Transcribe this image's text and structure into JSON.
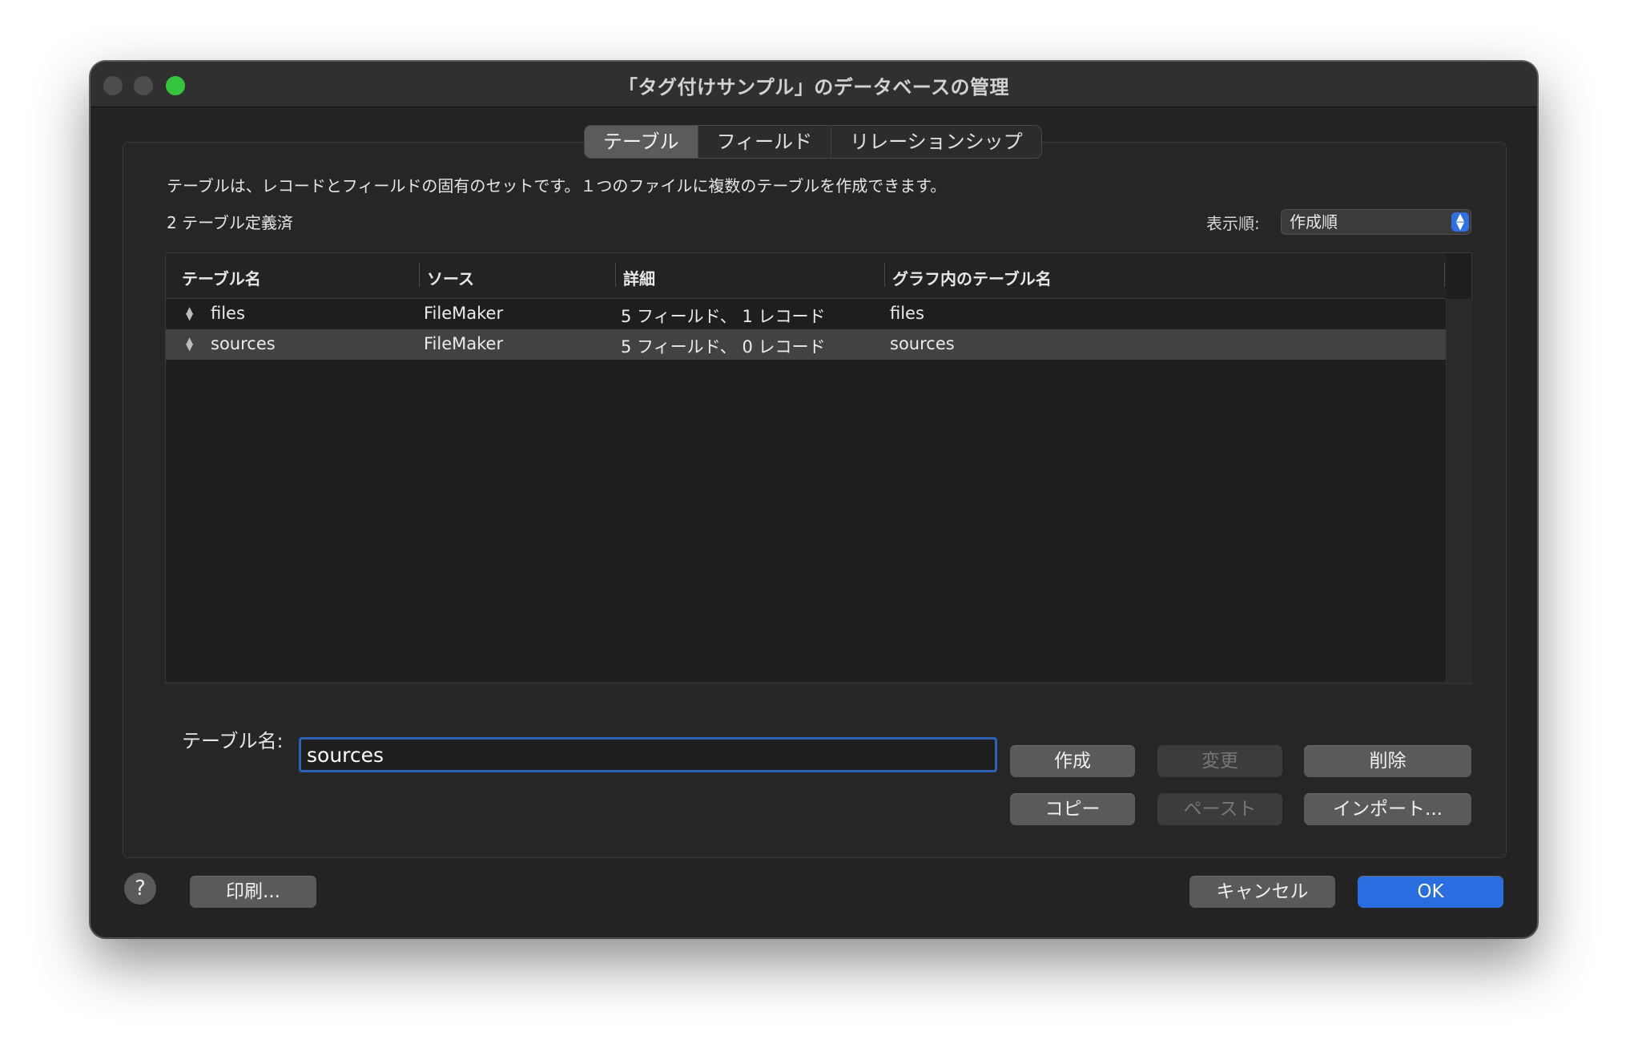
{
  "window": {
    "title": "「タグ付けサンプル」のデータベースの管理"
  },
  "tabs": [
    {
      "label": "テーブル",
      "active": true
    },
    {
      "label": "フィールド",
      "active": false
    },
    {
      "label": "リレーションシップ",
      "active": false
    }
  ],
  "description": "テーブルは、レコードとフィールドの固有のセットです。１つのファイルに複数のテーブルを作成できます。",
  "table_count": "2 テーブル定義済",
  "sort": {
    "label": "表示順:",
    "value": "作成順"
  },
  "table": {
    "columns": [
      "テーブル名",
      "ソース",
      "詳細",
      "グラフ内のテーブル名"
    ],
    "rows": [
      {
        "name": "files",
        "source": "FileMaker",
        "detail": "5 フィールド、 1 レコード",
        "graph_name": "files",
        "selected": false
      },
      {
        "name": "sources",
        "source": "FileMaker",
        "detail": "5 フィールド、 0 レコード",
        "graph_name": "sources",
        "selected": true
      }
    ]
  },
  "name_field": {
    "label": "テーブル名:",
    "value": "sources"
  },
  "buttons": {
    "create": "作成",
    "change": "変更",
    "delete": "削除",
    "copy": "コピー",
    "paste": "ペースト",
    "import": "インポート...",
    "print": "印刷...",
    "cancel": "キャンセル",
    "ok": "OK",
    "help": "?"
  },
  "colors": {
    "accent": "#2a6de1",
    "zoom_button": "#36c53e"
  }
}
